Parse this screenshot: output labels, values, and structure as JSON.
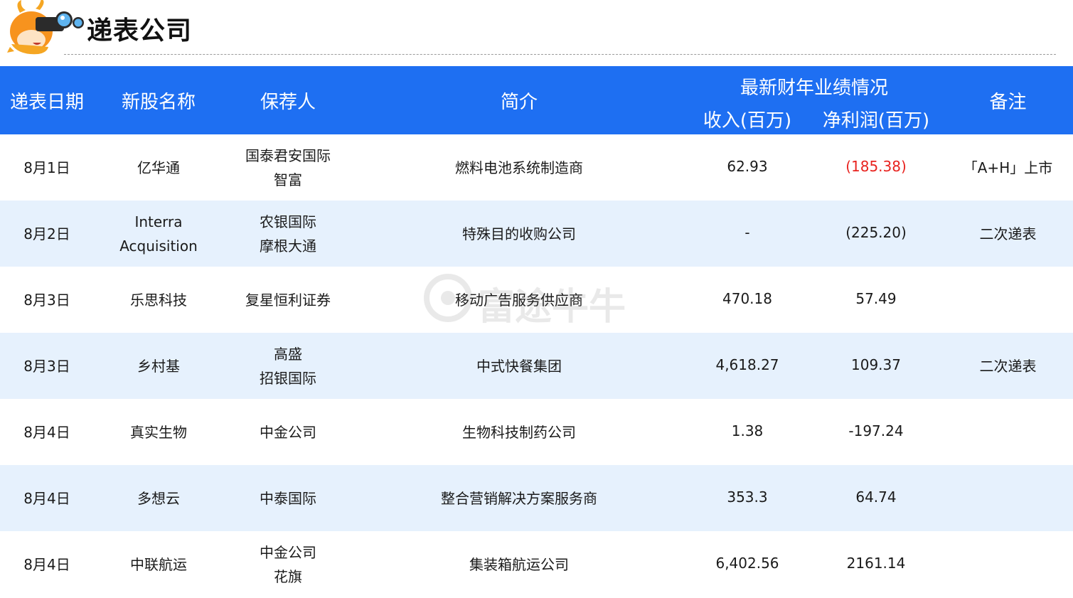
{
  "page": {
    "title": "递表公司"
  },
  "watermark": {
    "text": "富途牛牛"
  },
  "table": {
    "headers": {
      "date": "递表日期",
      "name": "新股名称",
      "sponsor": "保荐人",
      "desc": "简介",
      "group": "最新财年业绩情况",
      "revenue": "收入(百万)",
      "profit": "净利润(百万)",
      "note": "备注"
    },
    "rows": [
      {
        "date": "8月1日",
        "name": [
          "亿华通"
        ],
        "sponsors": [
          "国泰君安国际",
          "智富"
        ],
        "desc": "燃料电池系统制造商",
        "revenue": "62.93",
        "profit": "(185.38)",
        "profit_color": "#e8231f",
        "note": "「A+H」上市"
      },
      {
        "date": "8月2日",
        "name": [
          "Interra",
          "Acquisition"
        ],
        "sponsors": [
          "农银国际",
          "摩根大通"
        ],
        "desc": "特殊目的收购公司",
        "revenue": "-",
        "profit": "(225.20)",
        "profit_color": "#1a1a1a",
        "note": "二次递表"
      },
      {
        "date": "8月3日",
        "name": [
          "乐思科技"
        ],
        "sponsors": [
          "复星恒利证券"
        ],
        "desc": "移动广告服务供应商",
        "revenue": "470.18",
        "profit": "57.49",
        "profit_color": "#1a1a1a",
        "note": ""
      },
      {
        "date": "8月3日",
        "name": [
          "乡村基"
        ],
        "sponsors": [
          "高盛",
          "招银国际"
        ],
        "desc": "中式快餐集团",
        "revenue": "4,618.27",
        "profit": "109.37",
        "profit_color": "#1a1a1a",
        "note": "二次递表"
      },
      {
        "date": "8月4日",
        "name": [
          "真实生物"
        ],
        "sponsors": [
          "中金公司"
        ],
        "desc": "生物科技制药公司",
        "revenue": "1.38",
        "profit": "-197.24",
        "profit_color": "#1a1a1a",
        "note": ""
      },
      {
        "date": "8月4日",
        "name": [
          "多想云"
        ],
        "sponsors": [
          "中泰国际"
        ],
        "desc": "整合营销解决方案服务商",
        "revenue": "353.3",
        "profit": "64.74",
        "profit_color": "#1a1a1a",
        "note": ""
      },
      {
        "date": "8月4日",
        "name": [
          "中联航运"
        ],
        "sponsors": [
          "中金公司",
          "花旗"
        ],
        "desc": "集装箱航运公司",
        "revenue": "6,402.56",
        "profit": "2161.14",
        "profit_color": "#1a1a1a",
        "note": ""
      }
    ]
  },
  "colors": {
    "header_bg": "#1e6ff2",
    "alt_row_bg": "#e6f1fd",
    "negative": "#e8231f",
    "mascot": "#f5a623"
  }
}
